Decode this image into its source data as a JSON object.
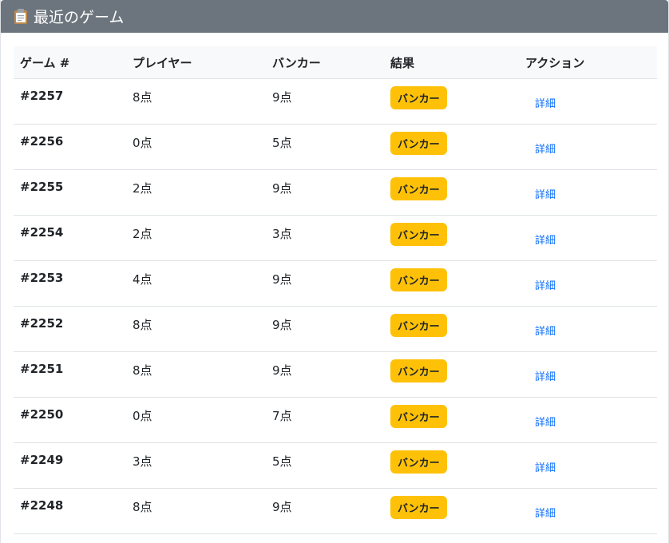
{
  "header": {
    "title": "最近のゲーム",
    "icon": "clipboard-icon"
  },
  "table": {
    "columns": [
      "ゲーム #",
      "プレイヤー",
      "バンカー",
      "結果",
      "アクション"
    ],
    "rows": [
      {
        "game": "#2257",
        "player": "8点",
        "banker": "9点",
        "result": "バンカー",
        "action": "詳細"
      },
      {
        "game": "#2256",
        "player": "0点",
        "banker": "5点",
        "result": "バンカー",
        "action": "詳細"
      },
      {
        "game": "#2255",
        "player": "2点",
        "banker": "9点",
        "result": "バンカー",
        "action": "詳細"
      },
      {
        "game": "#2254",
        "player": "2点",
        "banker": "3点",
        "result": "バンカー",
        "action": "詳細"
      },
      {
        "game": "#2253",
        "player": "4点",
        "banker": "9点",
        "result": "バンカー",
        "action": "詳細"
      },
      {
        "game": "#2252",
        "player": "8点",
        "banker": "9点",
        "result": "バンカー",
        "action": "詳細"
      },
      {
        "game": "#2251",
        "player": "8点",
        "banker": "9点",
        "result": "バンカー",
        "action": "詳細"
      },
      {
        "game": "#2250",
        "player": "0点",
        "banker": "7点",
        "result": "バンカー",
        "action": "詳細"
      },
      {
        "game": "#2249",
        "player": "3点",
        "banker": "5点",
        "result": "バンカー",
        "action": "詳細"
      },
      {
        "game": "#2248",
        "player": "8点",
        "banker": "9点",
        "result": "バンカー",
        "action": "詳細"
      }
    ]
  },
  "colors": {
    "header_bg": "#6c757d",
    "badge_bg": "#ffc107",
    "link": "#0d6efd"
  }
}
